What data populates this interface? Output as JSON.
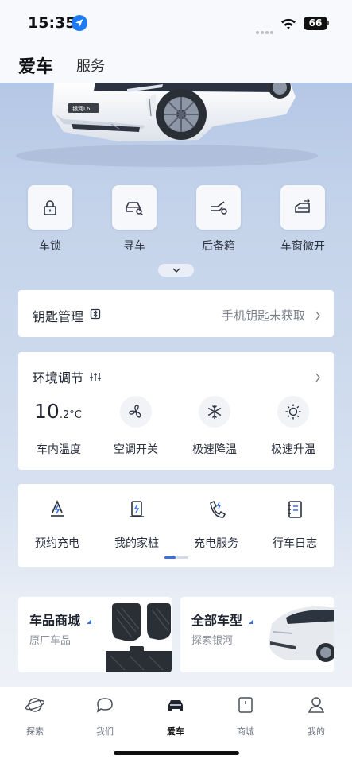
{
  "status_bar": {
    "time": "15:35",
    "battery": "66"
  },
  "header": {
    "active_tab": "爱车",
    "other_tab": "服务"
  },
  "car": {
    "plate_text": "银河L6"
  },
  "quick_controls": [
    {
      "label": "车锁",
      "icon": "lock-icon"
    },
    {
      "label": "寻车",
      "icon": "find-car-icon"
    },
    {
      "label": "后备箱",
      "icon": "trunk-icon"
    },
    {
      "label": "车窗微开",
      "icon": "window-icon"
    }
  ],
  "key_management": {
    "title": "钥匙管理",
    "status": "手机钥匙未获取"
  },
  "climate": {
    "title": "环境调节",
    "temperature": "10",
    "temperature_unit": ".2°C",
    "temperature_label": "车内温度",
    "controls": [
      {
        "label": "空调开关",
        "icon": "fan-icon"
      },
      {
        "label": "极速降温",
        "icon": "snowflake-icon"
      },
      {
        "label": "极速升温",
        "icon": "sun-icon"
      }
    ]
  },
  "charging": {
    "items": [
      {
        "label": "预约充电",
        "icon": "scheduled-charging-icon"
      },
      {
        "label": "我的家桩",
        "icon": "home-charger-icon"
      },
      {
        "label": "充电服务",
        "icon": "charging-service-icon"
      },
      {
        "label": "行车日志",
        "icon": "driving-log-icon"
      }
    ]
  },
  "promos": [
    {
      "title": "车品商城",
      "subtitle": "原厂车品"
    },
    {
      "title": "全部车型",
      "subtitle": "探索银河"
    }
  ],
  "bottom_nav": {
    "items": [
      {
        "label": "探索",
        "icon": "planet-icon"
      },
      {
        "label": "我们",
        "icon": "chat-icon"
      },
      {
        "label": "爱车",
        "icon": "car-icon"
      },
      {
        "label": "商城",
        "icon": "shop-icon"
      },
      {
        "label": "我的",
        "icon": "profile-icon"
      }
    ],
    "active": "爱车"
  },
  "colors": {
    "accent": "#3c6fe0",
    "background": "#c6d4ea",
    "card": "#ffffff"
  }
}
